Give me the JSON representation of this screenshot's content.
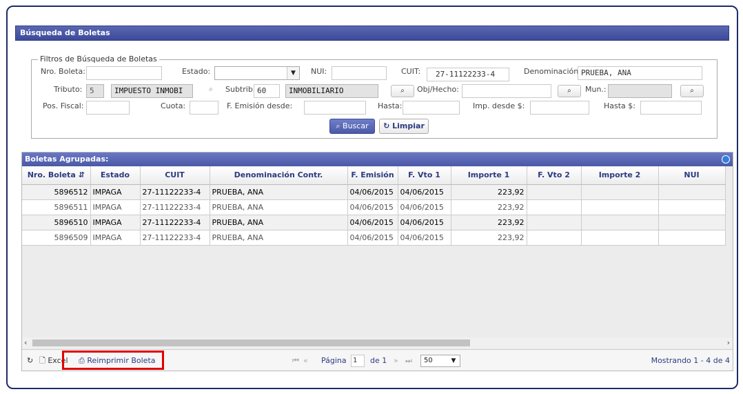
{
  "panel": {
    "title": "Búsqueda de Boletas"
  },
  "filters": {
    "legend": "Filtros de Búsqueda de Boletas",
    "nro_boleta_label": "Nro. Boleta:",
    "estado_label": "Estado:",
    "nui_label": "NUI:",
    "cuit_label": "CUIT:",
    "cuit_value": "27-11122233-4",
    "denominacion_label": "Denominación:",
    "denominacion_value": "PRUEBA, ANA",
    "tributo_label": "Tributo:",
    "tributo_code": "5",
    "tributo_desc": "IMPUESTO INMOBI",
    "subtrib_label": "Subtrib.:",
    "subtrib_code": "60",
    "subtrib_desc": "INMOBILIARIO",
    "obj_hecho_label": "Obj/Hecho:",
    "mun_label": "Mun.:",
    "pos_fiscal_label": "Pos. Fiscal:",
    "cuota_label": "Cuota:",
    "f_emision_label": "F. Emisión desde:",
    "hasta_label": "Hasta:",
    "imp_desde_label": "Imp. desde $:",
    "imp_hasta_label": "Hasta $:",
    "buscar_label": "Buscar",
    "limpiar_label": "Limpiar"
  },
  "grid": {
    "title": "Boletas Agrupadas:",
    "columns": [
      "Nro. Boleta",
      "Estado",
      "CUIT",
      "Denominación Contr.",
      "F. Emisión",
      "F. Vto 1",
      "Importe 1",
      "F. Vto 2",
      "Importe 2",
      "NUI"
    ],
    "rows": [
      {
        "nro": "5896512",
        "estado": "IMPAGA",
        "cuit": "27-11122233-4",
        "denom": "PRUEBA, ANA",
        "femision": "04/06/2015",
        "fvto1": "04/06/2015",
        "imp1": "223,92",
        "fvto2": "",
        "imp2": "",
        "nui": ""
      },
      {
        "nro": "5896511",
        "estado": "IMPAGA",
        "cuit": "27-11122233-4",
        "denom": "PRUEBA, ANA",
        "femision": "04/06/2015",
        "fvto1": "04/06/2015",
        "imp1": "223,92",
        "fvto2": "",
        "imp2": "",
        "nui": ""
      },
      {
        "nro": "5896510",
        "estado": "IMPAGA",
        "cuit": "27-11122233-4",
        "denom": "PRUEBA, ANA",
        "femision": "04/06/2015",
        "fvto1": "04/06/2015",
        "imp1": "223,92",
        "fvto2": "",
        "imp2": "",
        "nui": ""
      },
      {
        "nro": "5896509",
        "estado": "IMPAGA",
        "cuit": "27-11122233-4",
        "denom": "PRUEBA, ANA",
        "femision": "04/06/2015",
        "fvto1": "04/06/2015",
        "imp1": "223,92",
        "fvto2": "",
        "imp2": "",
        "nui": ""
      }
    ]
  },
  "pager": {
    "excel_label": "Excel",
    "reimprimir_label": "Reimprimir Boleta",
    "pagina_label": "Página",
    "page_value": "1",
    "de_label": "de 1",
    "rows_per_page": "50",
    "mostrando": "Mostrando 1 - 4 de 4"
  },
  "colors": {
    "header": "#4a58a6",
    "highlight": "#e00000"
  }
}
